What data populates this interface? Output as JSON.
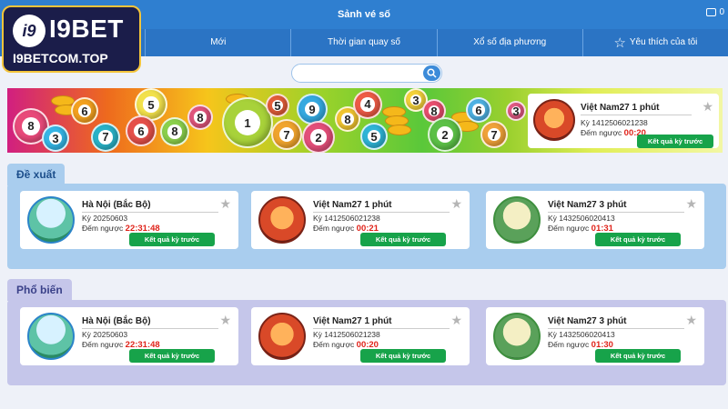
{
  "header": {
    "title": "Sảnh vé số",
    "balance": "0"
  },
  "tabs": [
    {
      "label": "Mới"
    },
    {
      "label": "Thời gian quay số"
    },
    {
      "label": "Xổ số địa phương"
    },
    {
      "label": "Yêu thích của tôi"
    }
  ],
  "logo": {
    "mark": "i9",
    "brand": "I9BET",
    "url": "I9BETCOM.TOP"
  },
  "search": {
    "placeholder": "",
    "value": ""
  },
  "banner": {
    "balls": [
      "8",
      "3",
      "6",
      "7",
      "5",
      "6",
      "8",
      "8",
      "1",
      "7",
      "5",
      "9",
      "2",
      "8",
      "4",
      "5",
      "3",
      "8",
      "2",
      "6",
      "7",
      "3"
    ],
    "card": {
      "name": "Việt Nam27 1 phút",
      "period": "Kỳ 1412506021238",
      "countdown_label": "Đếm ngược",
      "countdown": "00:20",
      "button": "Kết quả kỳ trước"
    }
  },
  "sections": [
    {
      "title": "Đề xuất",
      "cards": [
        {
          "name": "Hà Nội (Bắc Bộ)",
          "period": "Kỳ 20250603",
          "countdown_label": "Đếm ngược",
          "countdown": "22:31:48",
          "button": "Kết quả kỳ trước"
        },
        {
          "name": "Việt Nam27 1 phút",
          "period": "Kỳ 1412506021238",
          "countdown_label": "Đếm ngược",
          "countdown": "00:21",
          "button": "Kết quả kỳ trước"
        },
        {
          "name": "Việt Nam27 3 phút",
          "period": "Kỳ 1432506020413",
          "countdown_label": "Đếm ngược",
          "countdown": "01:31",
          "button": "Kết quả kỳ trước"
        }
      ]
    },
    {
      "title": "Phổ biến",
      "cards": [
        {
          "name": "Hà Nội (Bắc Bộ)",
          "period": "Kỳ 20250603",
          "countdown_label": "Đếm ngược",
          "countdown": "22:31:48",
          "button": "Kết quả kỳ trước"
        },
        {
          "name": "Việt Nam27 1 phút",
          "period": "Kỳ 1412506021238",
          "countdown_label": "Đếm ngược",
          "countdown": "00:20",
          "button": "Kết quả kỳ trước"
        },
        {
          "name": "Việt Nam27 3 phút",
          "period": "Kỳ 1432506020413",
          "countdown_label": "Đếm ngược",
          "countdown": "01:30",
          "button": "Kết quả kỳ trước"
        }
      ]
    }
  ],
  "colors": {
    "primary": "#2f7fd0",
    "accent_green": "#17a34a",
    "countdown_red": "#e0231a"
  }
}
